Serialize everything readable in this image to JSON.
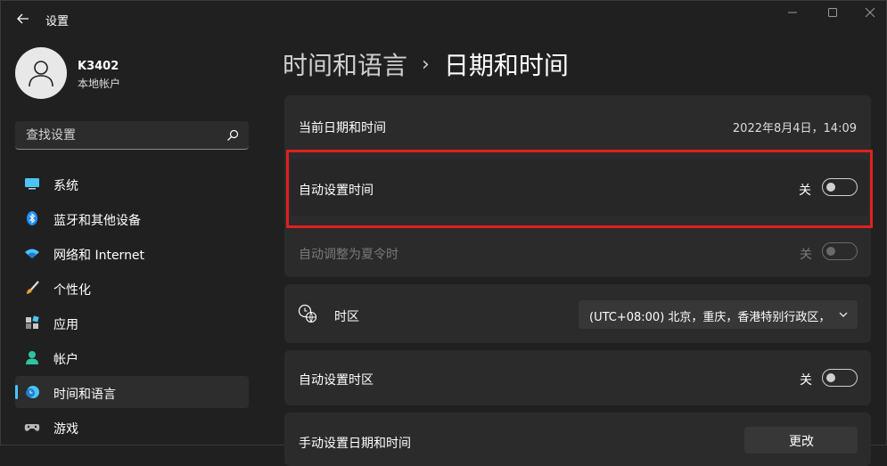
{
  "window": {
    "title": "设置"
  },
  "profile": {
    "name": "K3402",
    "account_type": "本地帐户"
  },
  "search": {
    "placeholder": "查找设置"
  },
  "sidebar": {
    "items": [
      {
        "label": "系统",
        "icon": "system-icon"
      },
      {
        "label": "蓝牙和其他设备",
        "icon": "bluetooth-icon"
      },
      {
        "label": "网络和 Internet",
        "icon": "wifi-icon"
      },
      {
        "label": "个性化",
        "icon": "brush-icon"
      },
      {
        "label": "应用",
        "icon": "apps-icon"
      },
      {
        "label": "帐户",
        "icon": "person-icon"
      },
      {
        "label": "时间和语言",
        "icon": "time-language-icon",
        "active": true
      },
      {
        "label": "游戏",
        "icon": "gamepad-icon"
      }
    ]
  },
  "header": {
    "parent": "时间和语言",
    "separator": "›",
    "current": "日期和时间"
  },
  "settings": {
    "current_datetime": {
      "label": "当前日期和时间",
      "value": "2022年8月4日，14:09"
    },
    "auto_time": {
      "label": "自动设置时间",
      "state": "关",
      "on": false
    },
    "auto_dst": {
      "label": "自动调整为夏令时",
      "state": "关",
      "on": false,
      "disabled": true
    },
    "timezone": {
      "label": "时区",
      "value": "(UTC+08:00) 北京，重庆，香港特别行政区，"
    },
    "auto_timezone": {
      "label": "自动设置时区",
      "state": "关",
      "on": false
    },
    "manual_datetime": {
      "label": "手动设置日期和时间",
      "button": "更改"
    }
  },
  "colors": {
    "accent": "#4cc2ff",
    "highlight": "#e02020",
    "background": "#202020",
    "card": "#2b2b2b"
  }
}
